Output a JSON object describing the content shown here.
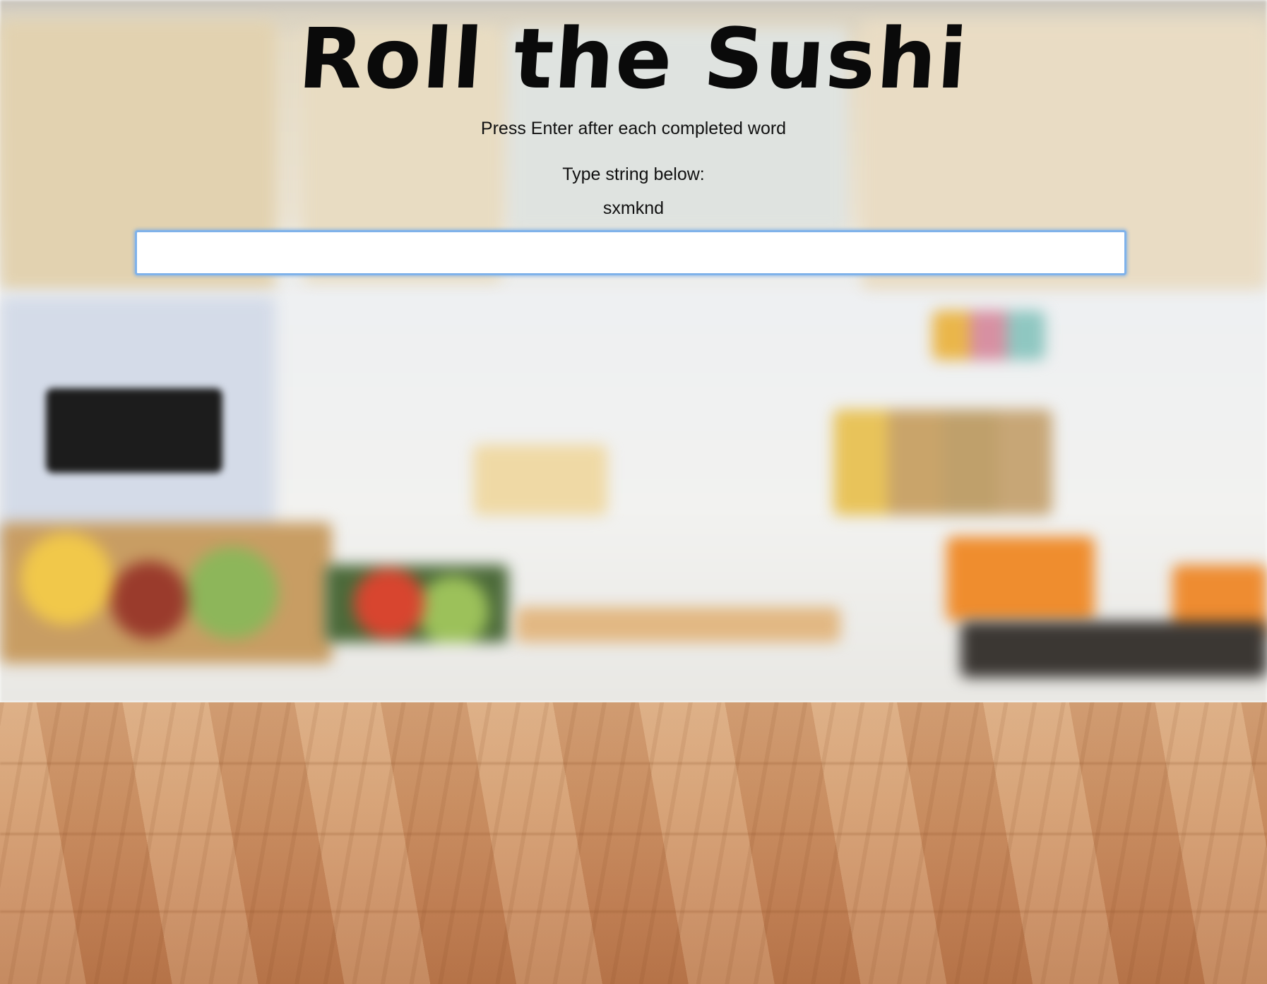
{
  "page": {
    "title": "Roll the Sushi",
    "instruction": "Press Enter after each completed word",
    "prompt_label": "Type string below:",
    "target_string": "sxmknd"
  },
  "input": {
    "value": "",
    "placeholder": ""
  },
  "colors": {
    "input_focus_border": "#7fb2ea",
    "text": "#111111"
  }
}
